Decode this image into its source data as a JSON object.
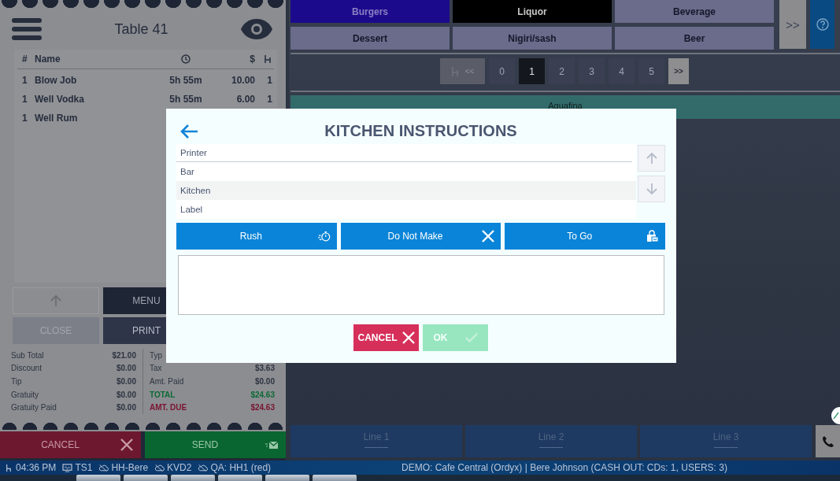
{
  "order": {
    "title": "Table 41",
    "columns": [
      {
        "kind": "text",
        "label": "#"
      },
      {
        "kind": "text",
        "label": "Name"
      },
      {
        "kind": "time"
      },
      {
        "kind": "text",
        "label": "$"
      },
      {
        "kind": "seat"
      }
    ],
    "rows": [
      {
        "qty": "1",
        "name": "Blow Job",
        "time": "5h 55m",
        "price": "10.00",
        "seats": "1"
      },
      {
        "qty": "1",
        "name": "Well Vodka",
        "time": "5h 55m",
        "price": "6.00",
        "seats": "1"
      },
      {
        "qty": "1",
        "name": "Well Rum"
      }
    ],
    "buttons": [
      {
        "kind": "up"
      },
      {
        "kind": "text",
        "label": "MENU",
        "disabled": false
      },
      {
        "kind": "text",
        "label": "CLOSE",
        "disabled": true
      },
      {
        "kind": "text",
        "label": "PRINT",
        "disabled": false
      }
    ],
    "totals_left": [
      {
        "label": "Sub Total",
        "value": "$21.00"
      },
      {
        "label": "Discount",
        "value": "$0.00"
      },
      {
        "label": "Tip",
        "value": "$0.00"
      },
      {
        "label": "Gratuity",
        "value": "$0.00"
      },
      {
        "label": "Gratuity Paid",
        "value": "$0.00"
      }
    ],
    "totals_right": [
      {
        "label": "Typ",
        "kind": "normal"
      },
      {
        "label": "Tax",
        "value": "$3.63",
        "kind": "normal"
      },
      {
        "label": "Amt. Paid",
        "value": "$0.00",
        "kind": "normal"
      },
      {
        "label": "TOTAL",
        "value": "$24.63",
        "kind": "total"
      },
      {
        "label": "AMT. DUE",
        "value": "$24.63",
        "kind": "due"
      }
    ],
    "cancel": "CANCEL",
    "send": "SEND"
  },
  "categories": [
    {
      "label": "Burgers",
      "color": "#1c0a8c"
    },
    {
      "label": "Liquor",
      "color": "#000000"
    },
    {
      "label": "Beverage",
      "color": "#6b6b8b"
    },
    {
      "label": "Dessert",
      "color": "#6b6b8b"
    },
    {
      "label": "Nigiri/sash",
      "color": "#6b6b8b"
    },
    {
      "label": "Beer",
      "color": "#6b6b8b"
    }
  ],
  "more_button": ">>",
  "pages": [
    {
      "kind": "back",
      "label": "<<",
      "disabled": true
    },
    {
      "kind": "page",
      "label": "0",
      "selected": false
    },
    {
      "kind": "page",
      "label": "1",
      "selected": true
    },
    {
      "kind": "page",
      "label": "2",
      "selected": false
    },
    {
      "kind": "page",
      "label": "3",
      "selected": false
    },
    {
      "kind": "page",
      "label": "4",
      "selected": false
    },
    {
      "kind": "page",
      "label": "5",
      "selected": false
    },
    {
      "kind": "next",
      "label": ">>"
    }
  ],
  "seat_bar": "Aquafina",
  "lines": [
    {
      "label": "Line 1",
      "value": "----------"
    },
    {
      "label": "Line 2",
      "value": "----------"
    },
    {
      "label": "Line 3",
      "value": "----------"
    }
  ],
  "status_bar": {
    "items": [
      {
        "kind": "time",
        "text": "04:36 PM"
      },
      {
        "kind": "terminal",
        "text": "TS1"
      },
      {
        "kind": "cloud",
        "text": "HH-Bere"
      },
      {
        "kind": "cloud",
        "text": "KVD2"
      },
      {
        "kind": "cloud",
        "text": "QA: HH1 (red)"
      }
    ],
    "info": "DEMO: Cafe Central (Ordyx) | Bere Johnson (CASH OUT: CDs: 1, USERS: 3)"
  },
  "dialog": {
    "title": "KITCHEN INSTRUCTIONS",
    "list_header": "Printer",
    "printers": [
      {
        "label": "Bar",
        "selected": false
      },
      {
        "label": "Kitchen",
        "selected": true
      },
      {
        "label": "Label",
        "selected": false
      }
    ],
    "actions": [
      {
        "label": "Rush",
        "kind": "rush"
      },
      {
        "label": "Do Not Make",
        "kind": "no"
      },
      {
        "label": "To Go",
        "kind": "togo"
      }
    ],
    "cancel": "CANCEL",
    "ok": {
      "label": "OK",
      "disabled": true
    }
  }
}
